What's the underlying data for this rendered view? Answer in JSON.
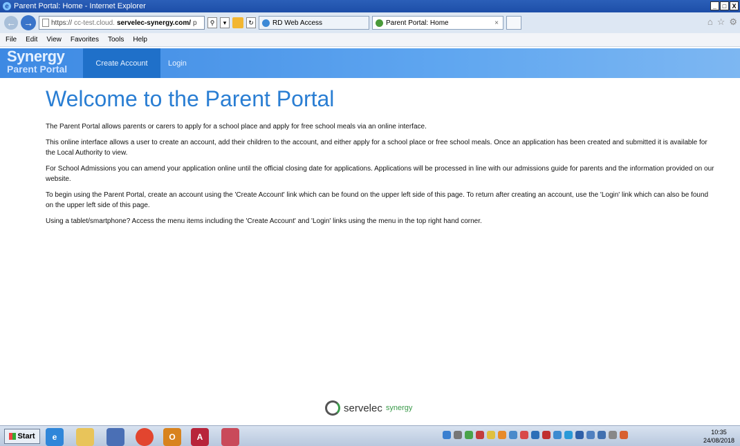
{
  "window": {
    "title": "Parent Portal: Home - Internet Explorer",
    "controls": [
      "_",
      "□",
      "X"
    ]
  },
  "browser": {
    "address": {
      "scheme": "https://",
      "host_dim": "cc-test.cloud.",
      "host_bold": "servelec-synergy.com/",
      "trail": "p"
    },
    "tabs": [
      {
        "label": "RD Web Access"
      },
      {
        "label": "Parent Portal: Home",
        "close": "×"
      }
    ]
  },
  "menubar": {
    "items": [
      "File",
      "Edit",
      "View",
      "Favorites",
      "Tools",
      "Help"
    ]
  },
  "site": {
    "logo_line1": "Synergy",
    "logo_line2": "Parent Portal",
    "nav": {
      "create_account": "Create Account",
      "login": "Login"
    }
  },
  "page": {
    "heading": "Welcome to the Parent Portal",
    "paragraphs": [
      "The Parent Portal allows parents or carers to apply for a school place and apply for free school meals via an online interface.",
      "This online interface allows a user to create an account, add their children to the account, and either apply for a school place or free school meals. Once an application has been created and submitted it is available for the Local Authority to view.",
      "For School Admissions you can amend your application online until the official closing date for applications. Applications will be processed in line with our admissions guide for parents and the information provided on our website.",
      "To begin using the Parent Portal, create an account using the 'Create Account' link which can be found on the upper left side of this page. To return after creating an account, use the 'Login' link which can also be found on the upper left side of this page.",
      "Using a tablet/smartphone? Access the menu items including the 'Create Account' and 'Login' links using the menu in the top right hand corner."
    ]
  },
  "footer": {
    "brand1": "servelec",
    "brand2": "synergy"
  },
  "taskbar": {
    "start": "Start",
    "time": "10:35",
    "date": "24/08/2018"
  },
  "colors": {
    "header_blue": "#3d89e3",
    "active_nav": "#1f70c9",
    "heading_blue": "#2a7ed3"
  }
}
